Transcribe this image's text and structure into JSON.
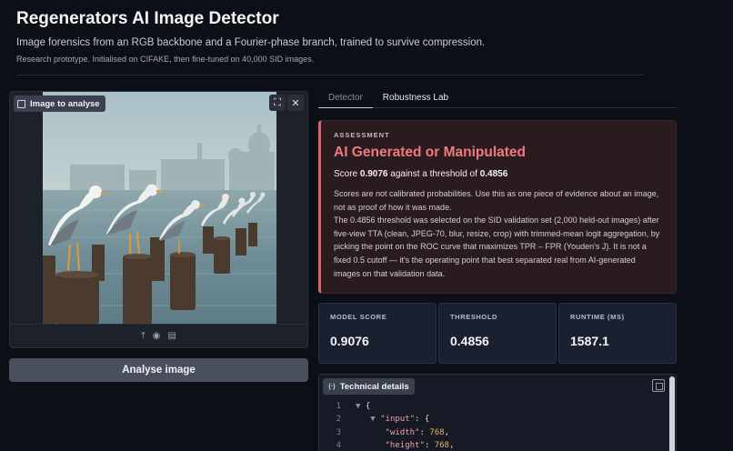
{
  "header": {
    "title": "Regenerators AI Image Detector",
    "subtitle": "Image forensics from an RGB backbone and a Fourier-phase branch, trained to survive compression.",
    "note": "Research prototype. Initialised on CIFAKE, then fine-tuned on 40,000 SID images."
  },
  "image_panel": {
    "label": "Image to analyse",
    "fullscreen_glyph": "⛶",
    "close_glyph": "✕",
    "upload_glyph": "⤒",
    "webcam_glyph": "◉",
    "clipboard_glyph": "▤"
  },
  "analyse_button": "Analyse image",
  "tabs": [
    {
      "label": "Detector",
      "active": true
    },
    {
      "label": "Robustness Lab",
      "active": false
    }
  ],
  "assessment": {
    "kicker": "ASSESSMENT",
    "verdict": "AI Generated or Manipulated",
    "score_prefix": "Score ",
    "score": "0.9076",
    "score_middle": " against a threshold of ",
    "threshold": "0.4856",
    "body_1": "Scores are not calibrated probabilities. Use this as one piece of evidence about an image, not as proof of how it was made.",
    "body_2": "The 0.4856 threshold was selected on the SID validation set (2,000 held-out images) after five-view TTA (clean, JPEG-70, blur, resize, crop) with trimmed-mean logit aggregation, by picking the point on the ROC curve that maximizes TPR – FPR (Youden's J). It is not a fixed 0.5 cutoff — it's the operating point that best separated real from AI-generated images on that validation data.",
    "accent": "#e0626a"
  },
  "metrics": [
    {
      "label": "MODEL SCORE",
      "value": "0.9076"
    },
    {
      "label": "THRESHOLD",
      "value": "0.4856"
    },
    {
      "label": "RUNTIME (MS)",
      "value": "1587.1"
    }
  ],
  "technical": {
    "label": "Technical details",
    "icon_glyph": "{·}",
    "lines": [
      {
        "n": "1",
        "toggle": "▼",
        "text": "{"
      },
      {
        "n": "2",
        "toggle": "▼",
        "key": "\"input\"",
        "rest": ": {"
      },
      {
        "n": "3",
        "toggle": "",
        "key": "\"width\"",
        "rest": ": ",
        "num": "768",
        "tail": ","
      },
      {
        "n": "4",
        "toggle": "",
        "key": "\"height\"",
        "rest": ": ",
        "num": "768",
        "tail": ","
      }
    ]
  }
}
